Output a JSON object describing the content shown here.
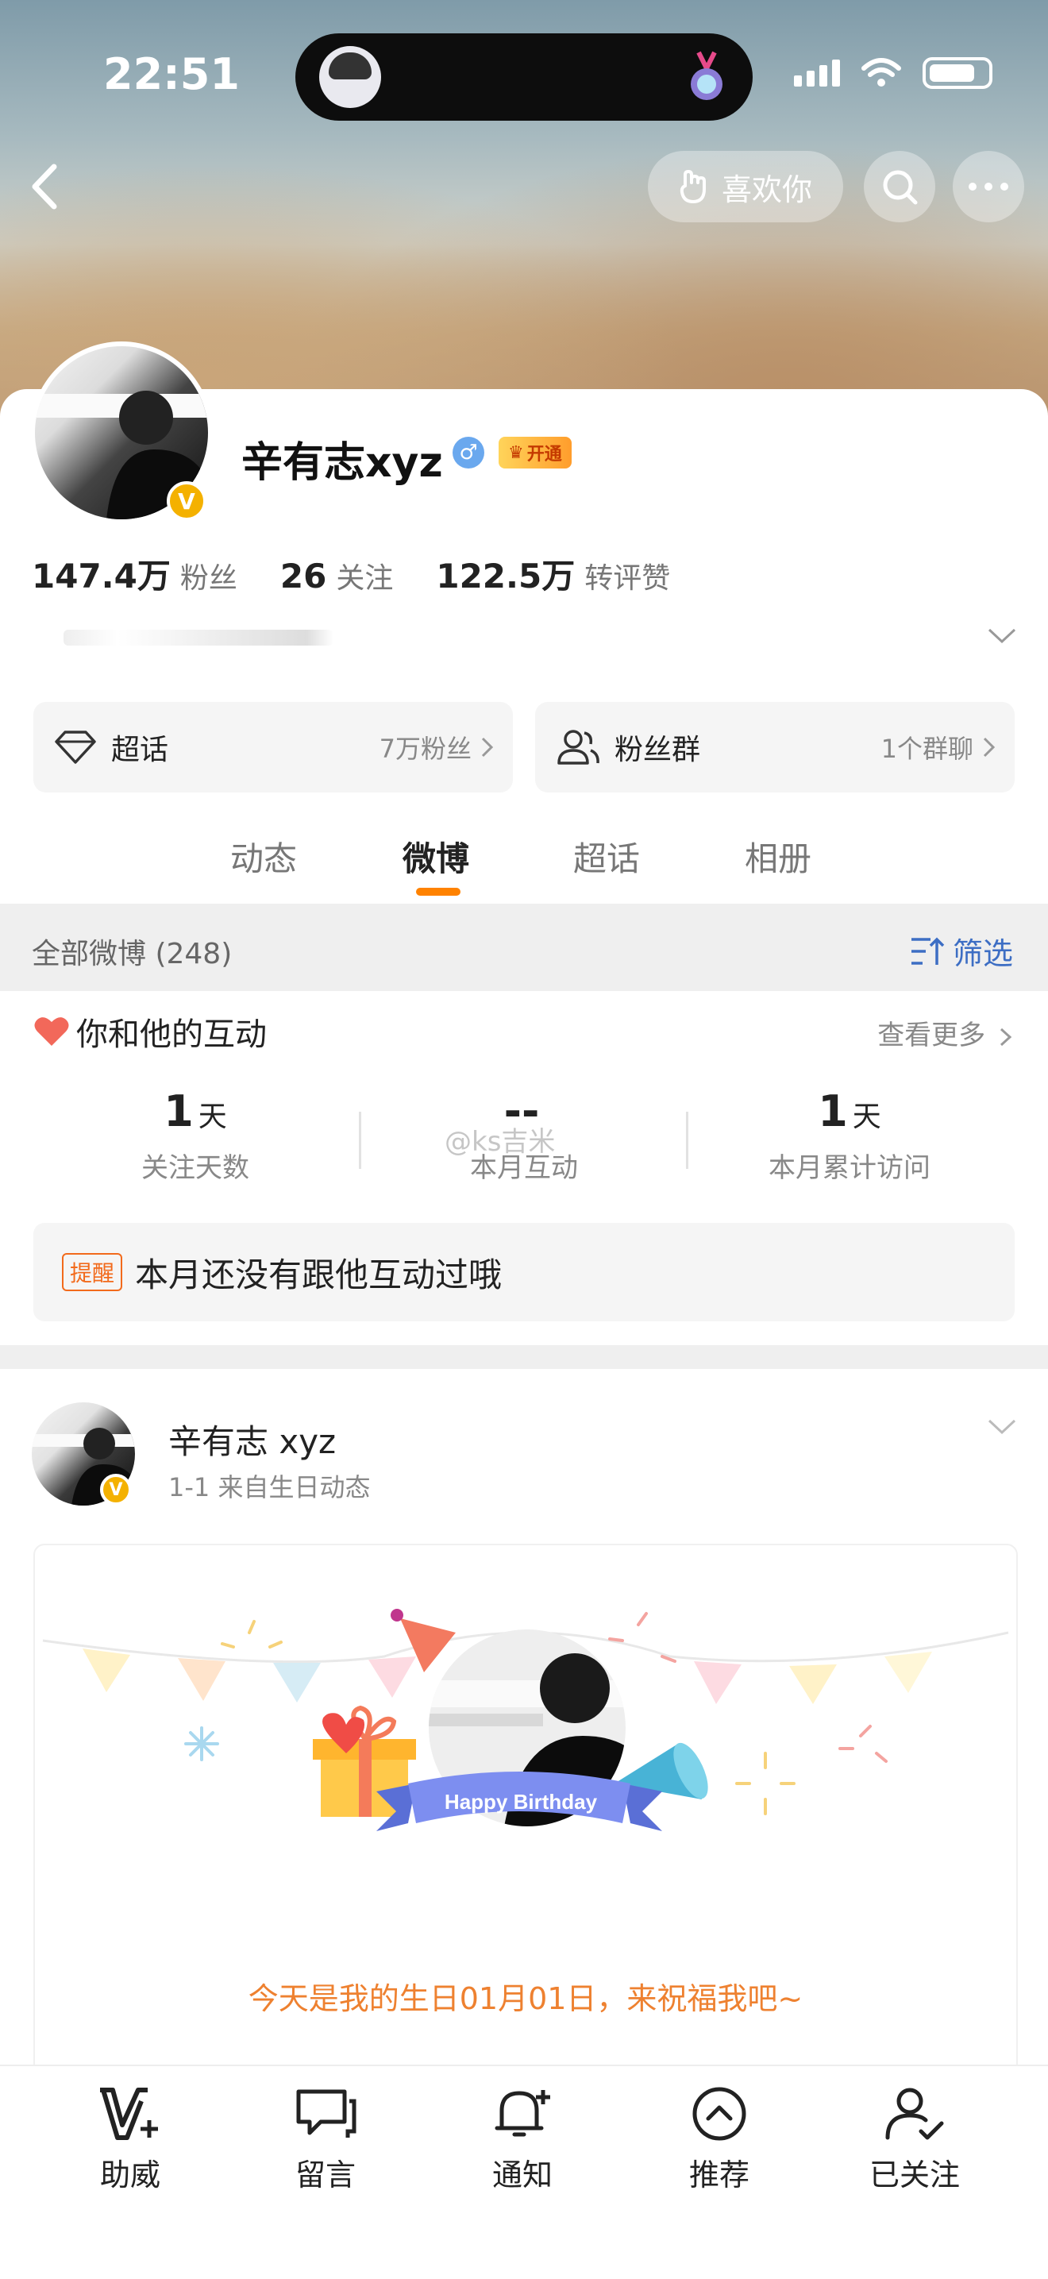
{
  "status_bar": {
    "time": "22:51"
  },
  "header": {
    "like_label": "喜欢你"
  },
  "profile": {
    "name": "辛有志xyz",
    "verified_badge": "V",
    "gender_symbol": "♂",
    "vip_label": "开通",
    "stats": [
      {
        "value": "147.4万",
        "label": "粉丝"
      },
      {
        "value": "26",
        "label": "关注"
      },
      {
        "value": "122.5万",
        "label": "转评赞"
      }
    ]
  },
  "entries": [
    {
      "icon": "diamond-icon",
      "title": "超话",
      "sub": "7万粉丝"
    },
    {
      "icon": "group-icon",
      "title": "粉丝群",
      "sub": "1个群聊"
    }
  ],
  "tabs": [
    {
      "label": "动态",
      "active": false
    },
    {
      "label": "微博",
      "active": true
    },
    {
      "label": "超话",
      "active": false
    },
    {
      "label": "相册",
      "active": false
    }
  ],
  "filter": {
    "count_label": "全部微博 (248)",
    "filter_label": "筛选"
  },
  "interaction": {
    "title": "你和他的互动",
    "see_more": "查看更多",
    "metrics": [
      {
        "value": "1",
        "unit": "天",
        "label": "关注天数"
      },
      {
        "value": "--",
        "unit": "",
        "label": "本月互动"
      },
      {
        "value": "1",
        "unit": "天",
        "label": "本月累计访问"
      }
    ],
    "watermark": "@ks吉米",
    "notice_tag": "提醒",
    "notice_text": "本月还没有跟他互动过哦"
  },
  "post": {
    "author": "辛有志 xyz",
    "meta": "1-1  来自生日动态",
    "badge": "V",
    "birthday_banner": "Happy Birthday",
    "birthday_text": "今天是我的生日01月01日，来祝福我吧~"
  },
  "bottom_nav": [
    {
      "label": "助威",
      "icon": "v-plus-icon"
    },
    {
      "label": "留言",
      "icon": "message-icon"
    },
    {
      "label": "通知",
      "icon": "bell-plus-icon"
    },
    {
      "label": "推荐",
      "icon": "up-circle-icon"
    },
    {
      "label": "已关注",
      "icon": "user-check-icon"
    }
  ],
  "colors": {
    "accent": "#ff8200",
    "link": "#3d6ec4",
    "birthday_text": "#ee8130",
    "verified": "#f4b100"
  }
}
